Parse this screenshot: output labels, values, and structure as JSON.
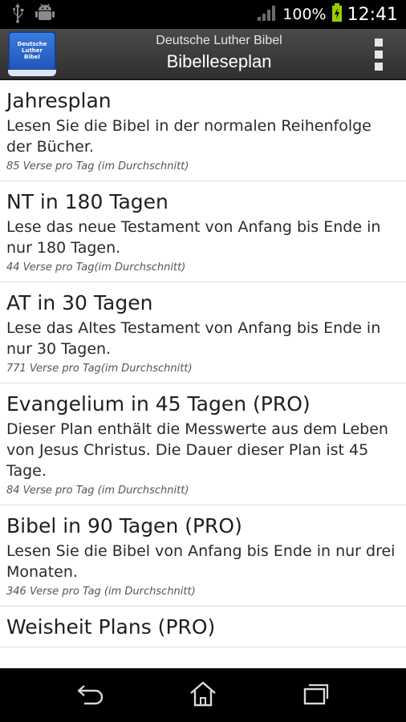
{
  "status_bar": {
    "icons": [
      "usb-icon",
      "android-debug-icon",
      "signal-icon",
      "battery-charging-icon"
    ],
    "battery": "100%",
    "time": "12:41"
  },
  "action_bar": {
    "app_icon_lines": [
      "Deutsche",
      "Luther",
      "Bibel"
    ],
    "subtitle": "Deutsche Luther Bibel",
    "title": "Bibelleseplan"
  },
  "plans": [
    {
      "title": "Jahresplan",
      "description": "Lesen Sie die Bibel in der normalen Reihenfolge der Bücher.",
      "meta": "85 Verse pro Tag (im Durchschnitt)"
    },
    {
      "title": "NT in 180 Tagen",
      "description": "Lese das neue Testament von Anfang bis Ende in nur 180 Tagen.",
      "meta": "44 Verse pro Tag(im Durchschnitt)"
    },
    {
      "title": "AT in 30 Tagen",
      "description": "Lese das Altes Testament von Anfang bis Ende in nur 30 Tagen.",
      "meta": "771 Verse pro Tag(im Durchschnitt)"
    },
    {
      "title": "Evangelium in 45 Tagen (PRO)",
      "description": "Dieser Plan enthält die Messwerte aus dem Leben von Jesus Christus. Die Dauer dieser Plan ist 45 Tage.",
      "meta": "84 Verse pro Tag (im Durchschnitt)"
    },
    {
      "title": "Bibel in 90 Tagen (PRO)",
      "description": "Lesen Sie die Bibel von Anfang bis Ende in nur drei Monaten.",
      "meta": "346 Verse pro Tag (im Durchschnitt)"
    },
    {
      "title": "Weisheit Plans (PRO)",
      "description": "",
      "meta": ""
    }
  ],
  "nav_bar": {
    "icons": [
      "back-icon",
      "home-icon",
      "recent-apps-icon"
    ]
  },
  "colors": {
    "action_bar": "#3c3c3c",
    "app_icon": "#2a62c9",
    "background": "#ffffff"
  }
}
